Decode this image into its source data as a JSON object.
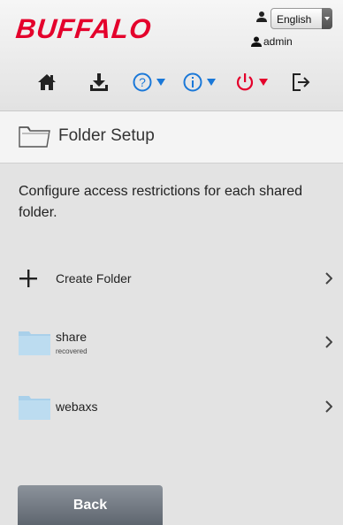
{
  "header": {
    "brand": "BUFFALO",
    "language": "English",
    "user": "admin",
    "toolbar": [
      {
        "icon": "home-icon"
      },
      {
        "icon": "download-icon"
      },
      {
        "icon": "help-icon",
        "dropdown": true
      },
      {
        "icon": "info-icon",
        "dropdown": true
      },
      {
        "icon": "power-icon",
        "dropdown": true
      },
      {
        "icon": "logout-icon"
      }
    ]
  },
  "page": {
    "title": "Folder Setup",
    "description": "Configure access restrictions for each shared folder."
  },
  "items": [
    {
      "label": "Create Folder",
      "icon": "plus-icon"
    },
    {
      "label": "share",
      "sublabel": "recovered",
      "icon": "folder-icon"
    },
    {
      "label": "webaxs",
      "icon": "folder-icon"
    }
  ],
  "footer": {
    "back_label": "Back"
  },
  "colors": {
    "brand": "#e4002b",
    "accent_blue": "#1a78d8",
    "folder": "#a9d0ea"
  }
}
